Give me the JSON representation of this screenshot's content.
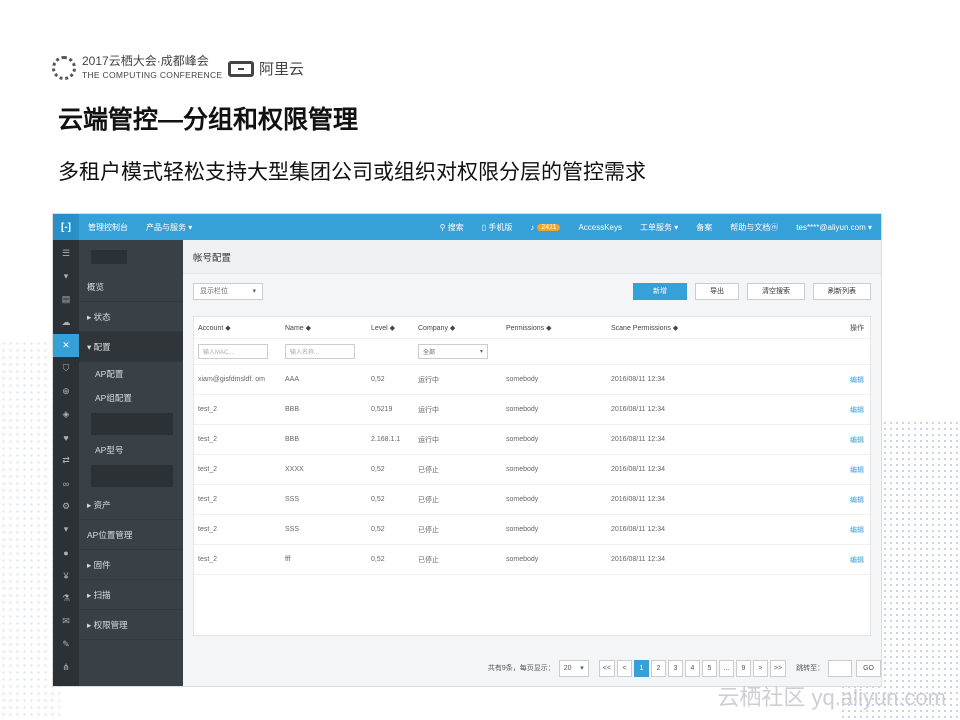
{
  "header": {
    "conference_line1": "2017云栖大会·成都峰会",
    "conference_line2": "THE COMPUTING CONFERENCE",
    "aliyun_label": "阿里云"
  },
  "slide": {
    "title": "云端管控—分组和权限管理",
    "subtitle": "多租户模式轻松支持大型集团公司或组织对权限分层的管控需求"
  },
  "topbar": {
    "logo": "[-]",
    "console": "管理控制台",
    "products": "产品与服务 ▾",
    "search": "搜索",
    "mobile": "手机版",
    "bell_count": "2411",
    "access_keys": "AccessKeys",
    "ticket": "工单服务 ▾",
    "beian": "备案",
    "help": "帮助与文档",
    "help_badge": "ⓜ",
    "user": "tes****@aliyun.com ▾"
  },
  "sidebar": {
    "items": [
      {
        "label": "概览"
      },
      {
        "label": "▸ 状态"
      },
      {
        "label": "▾ 配置"
      },
      {
        "label": "AP配置"
      },
      {
        "label": "AP组配置"
      },
      {
        "label": "AP型号"
      },
      {
        "label": "▸ 资产"
      },
      {
        "label": "AP位置管理"
      },
      {
        "label": "▸ 固件"
      },
      {
        "label": "▸ 扫描"
      },
      {
        "label": "▸ 权限管理"
      }
    ]
  },
  "main": {
    "title": "帐号配置",
    "column_select": "显示栏位",
    "buttons": {
      "add": "新增",
      "export": "导出",
      "clear": "清空搜索",
      "refresh": "刷新列表"
    },
    "columns": [
      "Account ◆",
      "Name ◆",
      "Level ◆",
      "Company ◆",
      "Permissions ◆",
      "Scane Permissions ◆",
      "操作"
    ],
    "filters": {
      "mac_placeholder": "输入MAC...",
      "name_placeholder": "输入名称...",
      "company_value": "全部"
    },
    "rows": [
      {
        "account": "xiam@gisfdmsldf. om",
        "name": "AAA",
        "level": "0,52",
        "company": "运行中",
        "permissions": "somebody",
        "scane": "2016/08/11  12:34",
        "action": "编辑"
      },
      {
        "account": "test_2",
        "name": "BBB",
        "level": "0,5219",
        "company": "运行中",
        "permissions": "somebody",
        "scane": "2016/08/11  12:34",
        "action": "编辑"
      },
      {
        "account": "test_2",
        "name": "BBB",
        "level": "2.168.1.1",
        "company": "运行中",
        "permissions": "somebody",
        "scane": "2016/08/11  12:34",
        "action": "编辑"
      },
      {
        "account": "test_2",
        "name": "XXXX",
        "level": "0,52",
        "company": "已停止",
        "permissions": "somebody",
        "scane": "2016/08/11  12:34",
        "action": "编辑"
      },
      {
        "account": "test_2",
        "name": "SSS",
        "level": "0,52",
        "company": "已停止",
        "permissions": "somebody",
        "scane": "2016/08/11  12:34",
        "action": "编辑"
      },
      {
        "account": "test_2",
        "name": "SSS",
        "level": "0,52",
        "company": "已停止",
        "permissions": "somebody",
        "scane": "2016/08/11  12:34",
        "action": "编辑"
      },
      {
        "account": "test_2",
        "name": "fff",
        "level": "0,52",
        "company": "已停止",
        "permissions": "somebody",
        "scane": "2016/08/11  12:34",
        "action": "编辑"
      }
    ]
  },
  "pager": {
    "summary": "共有9条，每页显示：",
    "page_size": "20",
    "first": "<<",
    "prev": "<",
    "pages": [
      "1",
      "2",
      "3",
      "4",
      "5",
      "...",
      "9"
    ],
    "next": ">",
    "last": ">>",
    "goto_label": "跳转至：",
    "go": "GO"
  },
  "watermark": "云栖社区 yq.aliyun.com"
}
